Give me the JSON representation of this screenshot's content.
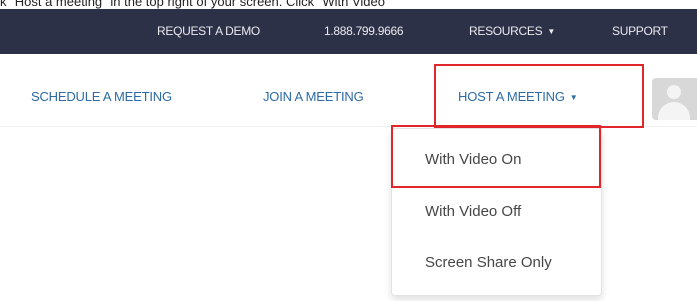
{
  "caption": "k \"Host a meeting\" in the top right of your screen. Click \"With Video",
  "topbar": {
    "request_demo": "REQUEST A DEMO",
    "phone": "1.888.799.9666",
    "resources": "RESOURCES",
    "support": "SUPPORT"
  },
  "nav": {
    "schedule": "SCHEDULE A MEETING",
    "join": "JOIN A MEETING",
    "host": "HOST A MEETING"
  },
  "dropdown": {
    "items": [
      "With Video On",
      "With Video Off",
      "Screen Share Only"
    ]
  },
  "colors": {
    "topbar_bg": "#2d3148",
    "nav_link": "#2c6ba7",
    "highlight_box": "#e0262b",
    "menu_text": "#464646"
  },
  "icons": {
    "caret": "chevron-down-icon",
    "avatar": "user-avatar-icon"
  }
}
